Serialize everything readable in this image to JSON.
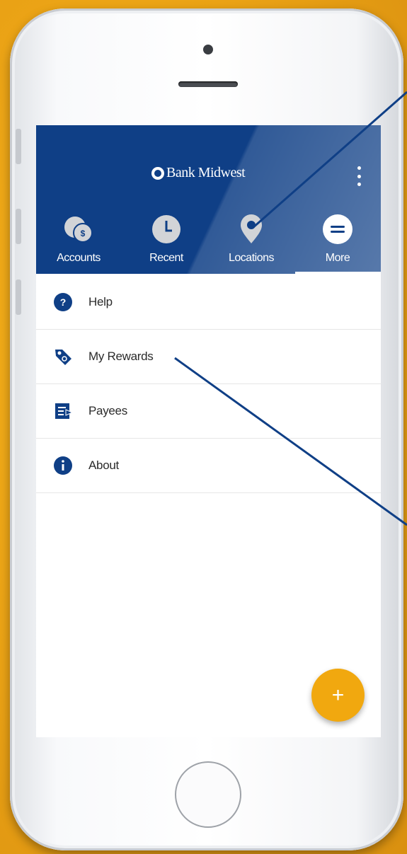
{
  "app": {
    "brand": "Bank Midwest"
  },
  "tabs": [
    {
      "label": "Accounts",
      "icon": "accounts-icon",
      "badge": "$"
    },
    {
      "label": "Recent",
      "icon": "clock-icon"
    },
    {
      "label": "Locations",
      "icon": "location-pin-icon"
    },
    {
      "label": "More",
      "icon": "more-menu-icon",
      "selected": true
    }
  ],
  "menu": [
    {
      "label": "Help",
      "icon": "help-icon"
    },
    {
      "label": "My Rewards",
      "icon": "rewards-tag-icon"
    },
    {
      "label": "Payees",
      "icon": "payees-icon"
    },
    {
      "label": "About",
      "icon": "info-icon"
    }
  ],
  "fab": {
    "label": "+"
  },
  "colors": {
    "primary": "#0f3f86",
    "accent": "#f1a80f",
    "background": "#eaa215",
    "icon_gray": "#d2d4d7"
  }
}
